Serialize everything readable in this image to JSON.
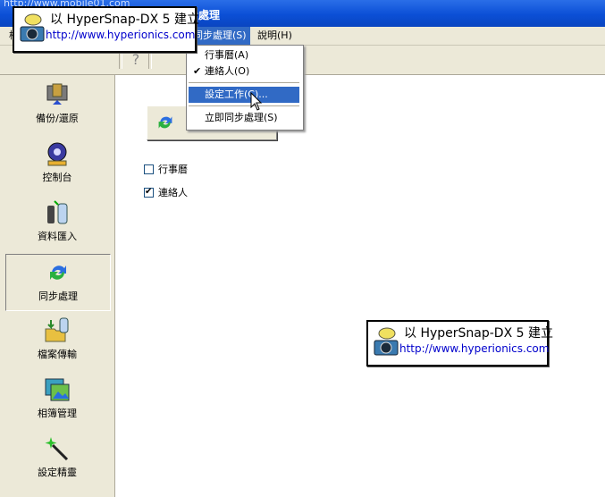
{
  "titlebar": {
    "title": "步處理",
    "ghost_url": "http://www.mobile01.com"
  },
  "menubar": {
    "items": [
      {
        "label": "檔"
      },
      {
        "label": "同步處理(S)"
      },
      {
        "label": "說明(H)"
      }
    ]
  },
  "toolbar": {
    "help_glyph": "?"
  },
  "sidebar": {
    "items": [
      {
        "label": "備份/還原",
        "icon": "backup-restore-icon"
      },
      {
        "label": "控制台",
        "icon": "control-panel-icon"
      },
      {
        "label": "資料匯入",
        "icon": "data-import-icon"
      },
      {
        "label": "同步處理",
        "icon": "sync-icon",
        "selected": true
      },
      {
        "label": "檔案傳輸",
        "icon": "file-transfer-icon"
      },
      {
        "label": "相簿管理",
        "icon": "album-icon"
      },
      {
        "label": "設定精靈",
        "icon": "wizard-icon"
      }
    ]
  },
  "dropdown": {
    "items": [
      {
        "label": "行事曆(A)",
        "checked": false
      },
      {
        "label": "連絡人(O)",
        "checked": true,
        "check_glyph": "✔"
      },
      {
        "label": "設定工作(C)...",
        "highlighted": true
      },
      {
        "label": "立即同步處理(S)"
      }
    ]
  },
  "content": {
    "checkboxes": [
      {
        "label": "行事曆",
        "checked": false
      },
      {
        "label": "連絡人",
        "checked": true,
        "check_glyph": "✔"
      }
    ]
  },
  "watermark": {
    "line1": "以 HyperSnap-DX 5 建立",
    "line2": "http://www.hyperionics.com"
  },
  "colors": {
    "titlebar": "#0b4fd6",
    "highlight": "#316ac5",
    "face": "#ece9d8"
  }
}
